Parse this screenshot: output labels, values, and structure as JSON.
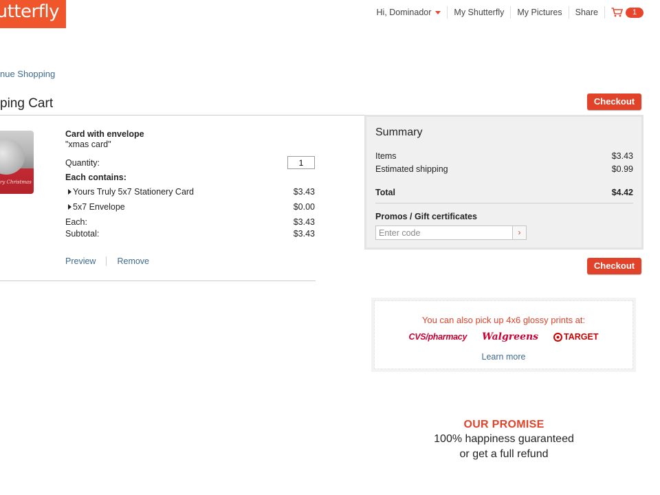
{
  "brand": {
    "logo_text": "hutterfly",
    "accent": "#e0432a"
  },
  "topnav": {
    "greeting": "Hi, Dominador",
    "links": [
      "My Shutterfly",
      "My Pictures",
      "Share"
    ],
    "cart_count": "1"
  },
  "page": {
    "continue_link": "nue Shopping",
    "title": "ping Cart",
    "checkout_label": "Checkout"
  },
  "cart_item": {
    "name": "Card with envelope",
    "subtitle": "\"xmas card\"",
    "thumb_text": "ry Christmas",
    "quantity_label": "Quantity:",
    "quantity": "1",
    "contains_label": "Each contains:",
    "contents": [
      {
        "name": "Yours Truly 5x7 Stationery Card",
        "price": "$3.43"
      },
      {
        "name": "5x7 Envelope",
        "price": "$0.00"
      }
    ],
    "each_label": "Each:",
    "each_value": "$3.43",
    "subtotal_label": "Subtotal:",
    "subtotal_value": "$3.43",
    "preview_label": "Preview",
    "remove_label": "Remove"
  },
  "summary": {
    "title": "Summary",
    "items_label": "Items",
    "items_value": "$3.43",
    "shipping_label": "Estimated shipping",
    "shipping_value": "$0.99",
    "total_label": "Total",
    "total_value": "$4.42",
    "promo_label": "Promos / Gift certificates",
    "promo_placeholder": "Enter code",
    "promo_go": "›"
  },
  "pickup": {
    "message": "You can also pick up 4x6 glossy prints at:",
    "stores": [
      "CVS/pharmacy",
      "Walgreens",
      "TARGET"
    ],
    "learn_more": "Learn more"
  },
  "promise": {
    "title": "OUR PROMISE",
    "line1": "100% happiness guaranteed",
    "line2": "or get a full refund"
  }
}
